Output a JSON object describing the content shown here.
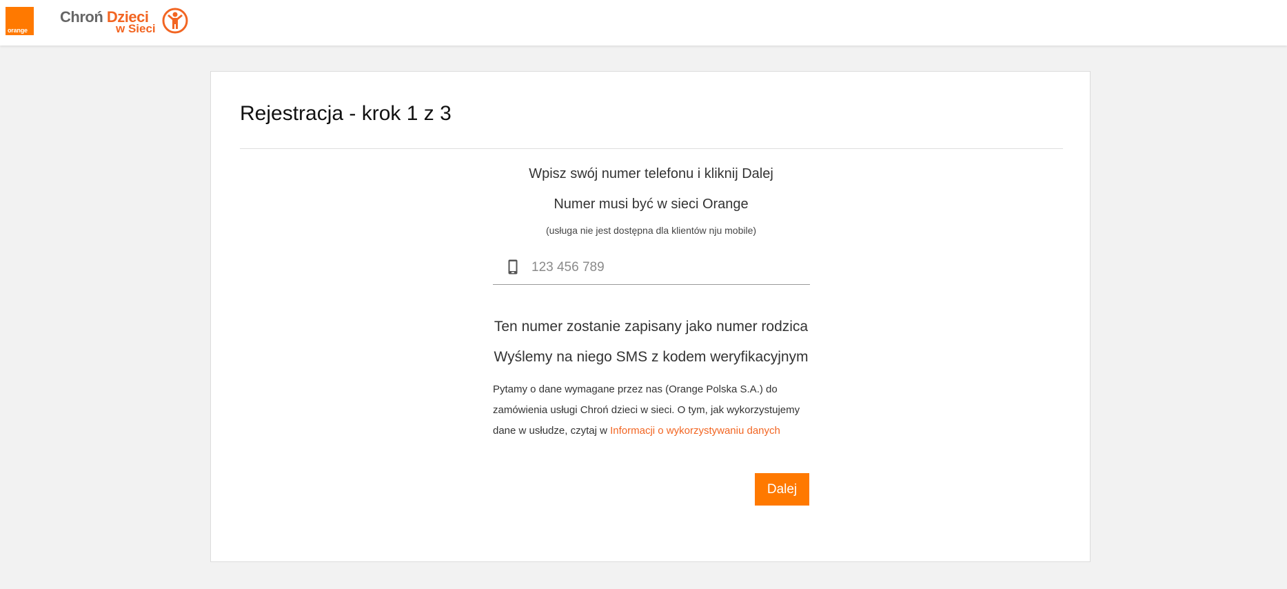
{
  "header": {
    "orange_logo_text": "orange",
    "brand_part1": "Chroń",
    "brand_part2": "Dzieci",
    "brand_part3": "w Sieci"
  },
  "card": {
    "title": "Rejestracja - krok 1 z 3",
    "instruction1": "Wpisz swój numer telefonu i kliknij Dalej",
    "instruction2": "Numer musi być w sieci Orange",
    "note": "(usługa nie jest dostępna dla klientów nju mobile)",
    "phone_placeholder": "123 456 789",
    "phone_value": "",
    "parent_info1": "Ten numer zostanie zapisany jako numer rodzica",
    "parent_info2": "Wyślemy na niego SMS z kodem weryfikacyjnym",
    "privacy_text": "Pytamy o dane wymagane przez nas (Orange Polska S.A.) do zamówienia usługi Chroń dzieci w sieci. O tym, jak wykorzystujemy dane w usłudze, czytaj w ",
    "privacy_link": "Informacji o wykorzystywaniu danych",
    "next_button": "Dalej"
  },
  "colors": {
    "brand_orange": "#ff7900",
    "link_orange": "#f26522",
    "background": "#f2f2f2"
  },
  "icons": {
    "phone": "mobile-phone-icon",
    "family": "family-figure-icon"
  }
}
